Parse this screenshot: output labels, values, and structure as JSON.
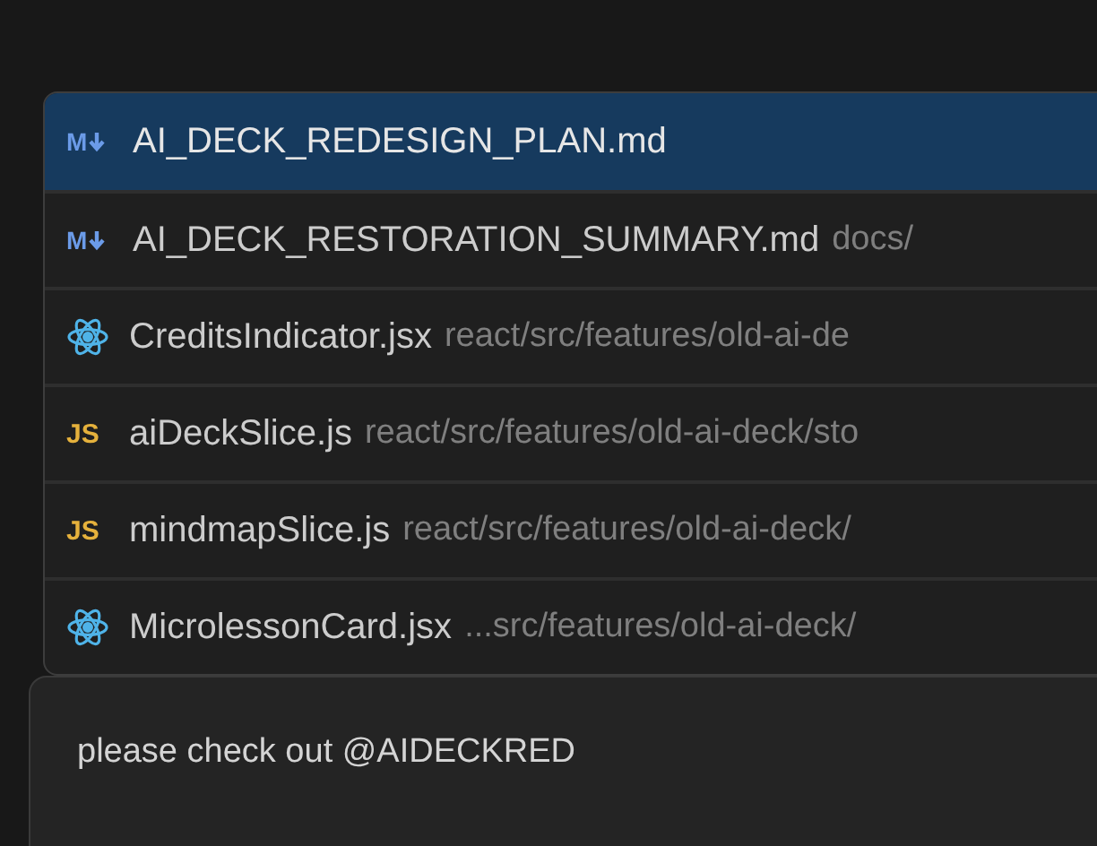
{
  "file_picker": {
    "items": [
      {
        "kind": "markdown",
        "icon_label": "M",
        "name": "AI_DECK_REDESIGN_PLAN.md",
        "selected": true
      },
      {
        "kind": "markdown",
        "icon_label": "M",
        "name": "AI_DECK_RESTORATION_SUMMARY.md",
        "path": "docs/",
        "selected": false
      },
      {
        "kind": "react",
        "name": "CreditsIndicator.jsx",
        "path": "react/src/features/old-ai-de",
        "selected": false
      },
      {
        "kind": "javascript",
        "icon_label": "JS",
        "name": "aiDeckSlice.js",
        "path": "react/src/features/old-ai-deck/sto",
        "selected": false
      },
      {
        "kind": "javascript",
        "icon_label": "JS",
        "name": "mindmapSlice.js",
        "path": "react/src/features/old-ai-deck/",
        "selected": false
      },
      {
        "kind": "react",
        "name": "MicrolessonCard.jsx",
        "path": "...src/features/old-ai-deck/",
        "selected": false
      }
    ]
  },
  "chat_input": {
    "value": "please check out @AIDECKRED"
  }
}
